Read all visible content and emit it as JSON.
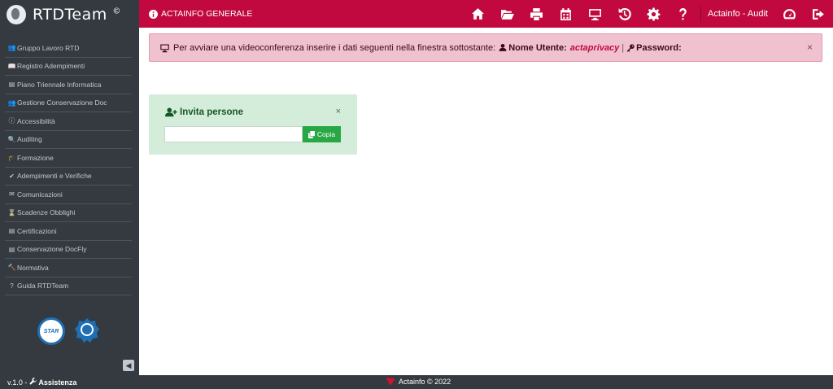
{
  "app": {
    "logo_text": "RTDTeam",
    "logo_mark": "©"
  },
  "sidebar": {
    "items": [
      {
        "label": "Gruppo Lavoro RTD",
        "icon": "users-icon",
        "glyph": "👥"
      },
      {
        "label": "Registro Adempimenti",
        "icon": "book-icon",
        "glyph": "📖"
      },
      {
        "label": "Piano Triennale Informatica",
        "icon": "document-icon",
        "glyph": "▤"
      },
      {
        "label": "Gestione Conservazione Doc",
        "icon": "users-icon",
        "glyph": "👥"
      },
      {
        "label": "Accessibilità",
        "icon": "info-icon",
        "glyph": "ⓘ"
      },
      {
        "label": "Auditing",
        "icon": "search-icon",
        "glyph": "🔍"
      },
      {
        "label": "Formazione",
        "icon": "graduation-cap-icon",
        "glyph": "🎓"
      },
      {
        "label": "Adempimenti e Verifiche",
        "icon": "check-icon",
        "glyph": "✔"
      },
      {
        "label": "Comunicazioni",
        "icon": "envelope-icon",
        "glyph": "✉"
      },
      {
        "label": "Scadenze Obblighi",
        "icon": "hourglass-icon",
        "glyph": "⌛"
      },
      {
        "label": "Certificazioni",
        "icon": "file-icon",
        "glyph": "▤"
      },
      {
        "label": "Conservazione DocFly",
        "icon": "archive-icon",
        "glyph": "▤"
      },
      {
        "label": "Normativa",
        "icon": "gavel-icon",
        "glyph": "🔨"
      },
      {
        "label": "Guida RTDTeam",
        "icon": "question-icon",
        "glyph": "?"
      }
    ],
    "badge_star_text": "STAR",
    "collapse_glyph": "◀"
  },
  "topbar": {
    "title": "ACTAINFO GENERALE",
    "user": "Actainfo - Audit",
    "icons": [
      "home-icon",
      "folder-open-icon",
      "print-icon",
      "calendar-icon",
      "monitor-icon",
      "history-icon",
      "gear-icon",
      "question-icon"
    ],
    "color": "#c2093f"
  },
  "alert": {
    "message": "Per avviare una videoconferenza inserire i dati seguenti nella finestra sottostante:",
    "username_label": "Nome Utente:",
    "username_value": "actaprivacy",
    "separator": "|",
    "password_label": "Password:",
    "close": "×"
  },
  "invite": {
    "title": "Invita persone",
    "input_value": "",
    "copy_label": "Copia",
    "close": "×"
  },
  "footer": {
    "version": "v.1.0 -",
    "assistance": "Assistenza",
    "copyright": "Actainfo © 2022"
  }
}
